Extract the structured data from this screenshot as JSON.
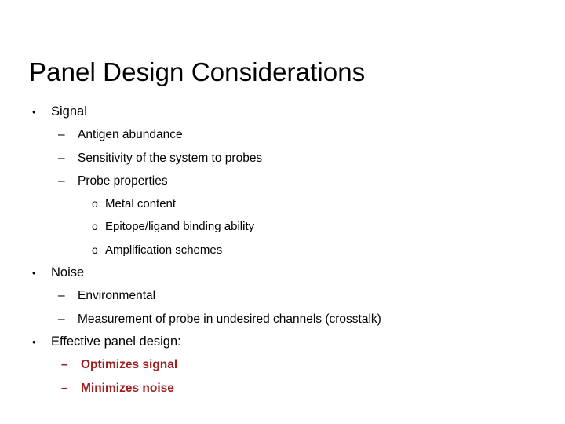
{
  "slide": {
    "title": "Panel Design Considerations",
    "background_color": "#FFFFFF",
    "default_text_color": "#000000",
    "emphasis_color": "#A01E20",
    "markers": {
      "level1": "•",
      "level2": "–",
      "level3": "o"
    },
    "bullets": [
      {
        "level": 1,
        "marker": "•",
        "text": "Signal",
        "color": "#000000",
        "bold": false
      },
      {
        "level": 2,
        "marker": "–",
        "text": "Antigen abundance",
        "color": "#000000",
        "bold": false
      },
      {
        "level": 2,
        "marker": "–",
        "text": "Sensitivity of the system to probes",
        "color": "#000000",
        "bold": false
      },
      {
        "level": 2,
        "marker": "–",
        "text": "Probe properties",
        "color": "#000000",
        "bold": false
      },
      {
        "level": 3,
        "marker": "o",
        "text": "Metal content",
        "color": "#000000",
        "bold": false
      },
      {
        "level": 3,
        "marker": "o",
        "text": "Epitope/ligand binding ability",
        "color": "#000000",
        "bold": false
      },
      {
        "level": 3,
        "marker": "o",
        "text": "Amplification schemes",
        "color": "#000000",
        "bold": false
      },
      {
        "level": 1,
        "marker": "•",
        "text": "Noise",
        "color": "#000000",
        "bold": false
      },
      {
        "level": 2,
        "marker": "–",
        "text": "Environmental",
        "color": "#000000",
        "bold": false
      },
      {
        "level": 2,
        "marker": "–",
        "text": "Measurement of probe in undesired channels (crosstalk)",
        "color": "#000000",
        "bold": false
      },
      {
        "level": 1,
        "marker": "•",
        "text": "Effective panel design:",
        "color": "#000000",
        "bold": false
      },
      {
        "level": 2,
        "marker": "–",
        "text": "Optimizes signal",
        "color": "#A01E20",
        "bold": true
      },
      {
        "level": 2,
        "marker": "–",
        "text": "Minimizes noise",
        "color": "#A01E20",
        "bold": true
      }
    ]
  }
}
